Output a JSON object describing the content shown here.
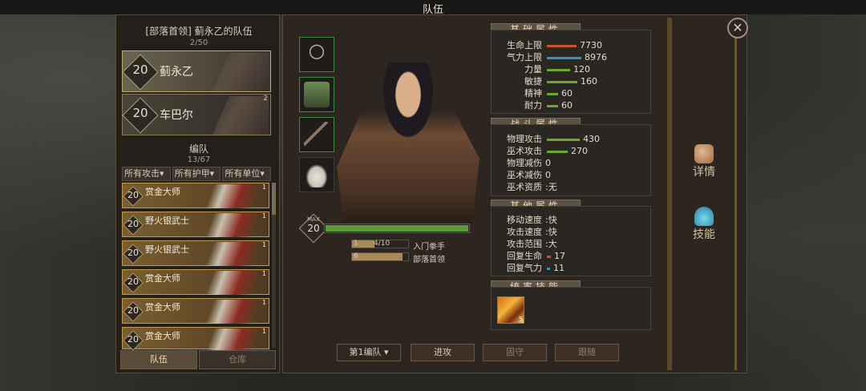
{
  "window": {
    "title": "队伍",
    "close_glyph": "✕"
  },
  "left_panel": {
    "header": "[部落首领] 蓟永乙的队伍",
    "member_count": "2/50",
    "heroes": [
      {
        "level": "20",
        "name": "蓟永乙",
        "selected": true
      },
      {
        "level": "20",
        "name": "车巴尔",
        "badge": "2",
        "selected": false
      }
    ],
    "formation_title": "编队",
    "formation_count": "13/67",
    "filters": [
      "所有攻击",
      "所有护甲",
      "所有单位"
    ],
    "units": [
      {
        "level": "20",
        "name": "赏金大师",
        "badge": "1"
      },
      {
        "level": "20",
        "name": "野火银武士",
        "badge": "1"
      },
      {
        "level": "20",
        "name": "野火银武士",
        "badge": "1"
      },
      {
        "level": "20",
        "name": "赏金大师",
        "badge": "1"
      },
      {
        "level": "20",
        "name": "赏金大师",
        "badge": "1"
      },
      {
        "level": "20",
        "name": "赏金大师",
        "badge": "1"
      }
    ],
    "bottom_tabs": [
      "队伍",
      "仓库"
    ]
  },
  "center": {
    "equipment_icons": [
      "necklace-icon",
      "armor-icon",
      "bow-icon",
      "wolf-mount-icon"
    ],
    "level": "20",
    "level_tag": "MAX",
    "health_fraction": 1.0,
    "xp_bars": [
      {
        "count": "4/10",
        "label": "入门拳手",
        "num": "1",
        "fraction": 0.4
      },
      {
        "count": "",
        "label": "部落首领",
        "num": "6",
        "fraction": 0.9
      }
    ]
  },
  "stats": {
    "basic_title": "基础属性",
    "basic": [
      {
        "label": "生命上限",
        "value": "7730",
        "bar_color": "#c8542e",
        "fraction": 0.77
      },
      {
        "label": "气力上限",
        "value": "8976",
        "bar_color": "#3a8fbf",
        "fraction": 0.9
      },
      {
        "label": "力量",
        "value": "120",
        "bar_color": "#6aa832",
        "fraction": 0.6
      },
      {
        "label": "敏捷",
        "value": "160",
        "bar_color": "#6aa832",
        "fraction": 0.8
      },
      {
        "label": "精神",
        "value": "60",
        "bar_color": "#6aa832",
        "fraction": 0.3
      },
      {
        "label": "耐力",
        "value": "60",
        "bar_color": "#6aa832",
        "fraction": 0.3
      }
    ],
    "combat_title": "战斗属性",
    "combat": [
      {
        "label": "物理攻击",
        "value": "430",
        "bar_color": "#6aa832",
        "fraction": 0.86
      },
      {
        "label": "巫术攻击",
        "value": "270",
        "bar_color": "#6aa832",
        "fraction": 0.54
      },
      {
        "label": "物理减伤",
        "value": "0",
        "bar_color": "",
        "fraction": 0
      },
      {
        "label": "巫术减伤",
        "value": "0",
        "bar_color": "",
        "fraction": 0
      },
      {
        "label": "巫术资质",
        "value": ":无",
        "bar_color": "",
        "fraction": 0
      }
    ],
    "other_title": "其他属性",
    "other": [
      {
        "label": "移动速度",
        "value": ":快",
        "bar_color": "",
        "fraction": 0
      },
      {
        "label": "攻击速度",
        "value": ":快",
        "bar_color": "",
        "fraction": 0
      },
      {
        "label": "攻击范围",
        "value": ":大",
        "bar_color": "",
        "fraction": 0
      },
      {
        "label": "回复生命",
        "value": "17",
        "bar_color": "#c8542e",
        "fraction": 0.1
      },
      {
        "label": "回复气力",
        "value": "11",
        "bar_color": "#3a8fbf",
        "fraction": 0.05
      }
    ],
    "command_title": "统率技能",
    "command_skill_badge": "5"
  },
  "side_buttons": [
    {
      "label": "详情",
      "icon": "arm-icon"
    },
    {
      "label": "技能",
      "icon": "flame-book-icon"
    }
  ],
  "bottom_buttons": {
    "formation_select": "第1编队",
    "attack": "进攻",
    "defend": "固守",
    "follow": "跟随"
  }
}
